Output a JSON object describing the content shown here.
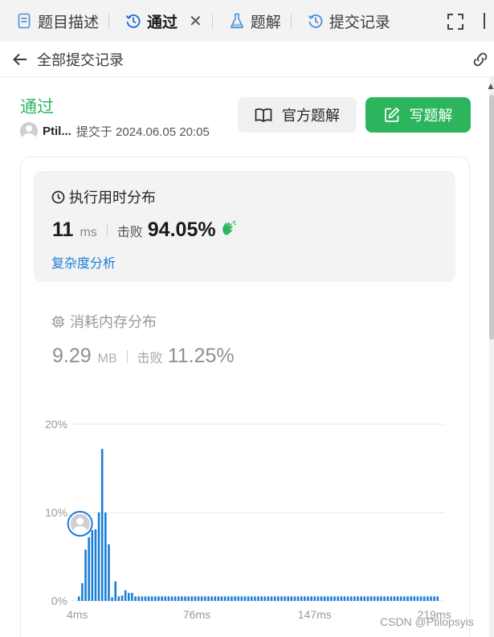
{
  "tabs": [
    {
      "label": "题目描述",
      "icon": "document-icon"
    },
    {
      "label": "通过",
      "icon": "history-icon"
    },
    {
      "label": "题解",
      "icon": "flask-icon"
    },
    {
      "label": "提交记录",
      "icon": "history-icon"
    }
  ],
  "toolbar": {
    "back_label": "全部提交记录"
  },
  "submission": {
    "status": "通过",
    "username": "Ptil...",
    "submitted_at": "提交于 2024.06.05 20:05",
    "official_solution_label": "官方题解",
    "write_solution_label": "写题解"
  },
  "runtime": {
    "title": "执行用时分布",
    "value": "11",
    "unit": "ms",
    "beats_label": "击败",
    "beats_pct": "94.05%",
    "complexity_link": "复杂度分析"
  },
  "memory": {
    "title": "消耗内存分布",
    "value": "9.29",
    "unit": "MB",
    "beats_label": "击败",
    "beats_pct": "11.25%"
  },
  "colors": {
    "accent_green": "#2db55d",
    "bar_blue": "#1a7ed8",
    "link_blue": "#1a7ed8"
  },
  "chart_data": {
    "type": "bar",
    "title": "",
    "xlabel": "",
    "ylabel": "",
    "x_ticks": [
      "4ms",
      "76ms",
      "147ms",
      "219ms"
    ],
    "y_ticks": [
      "0%",
      "10%",
      "20%"
    ],
    "ylim": [
      0,
      20
    ],
    "xlim_ms": [
      1,
      225
    ],
    "grid": true,
    "user_marker_ms": 11,
    "series": [
      {
        "x_ms": [
          5,
          7,
          9,
          11,
          13,
          15,
          17,
          19,
          21,
          23,
          25,
          27,
          29,
          31,
          33,
          35,
          37,
          39,
          41,
          43,
          45,
          47,
          49,
          51,
          53,
          55,
          57,
          59,
          61,
          63,
          65,
          67,
          69,
          71,
          73,
          75,
          77,
          79,
          81,
          83,
          85,
          87,
          89,
          91,
          93,
          95,
          97,
          99,
          101,
          103,
          105,
          107,
          109,
          111,
          113,
          115,
          117,
          119,
          121,
          123,
          125,
          127,
          129,
          131,
          133,
          135,
          137,
          139,
          141,
          143,
          145,
          147,
          149,
          151,
          153,
          155,
          157,
          159,
          161,
          163,
          165,
          167,
          169,
          171,
          173,
          175,
          177,
          179,
          181,
          183,
          185,
          187,
          189,
          191,
          193,
          195,
          197,
          199,
          201,
          203,
          205,
          207,
          209,
          211,
          213,
          215,
          217,
          219,
          221
        ],
        "values": [
          0.5,
          2.0,
          5.8,
          7.2,
          8.0,
          8.1,
          10.0,
          17.2,
          10.0,
          6.4,
          0.4,
          2.2,
          0.5,
          0.6,
          1.2,
          0.9,
          0.9,
          0.5,
          0.5,
          0.5,
          0.5,
          0.5,
          0.5,
          0.5,
          0.5,
          0.5,
          0.5,
          0.5,
          0.5,
          0.5,
          0.5,
          0.5,
          0.5,
          0.5,
          0.5,
          0.5,
          0.5,
          0.5,
          0.5,
          0.5,
          0.5,
          0.5,
          0.5,
          0.5,
          0.5,
          0.5,
          0.5,
          0.5,
          0.5,
          0.5,
          0.5,
          0.5,
          0.5,
          0.5,
          0.5,
          0.5,
          0.5,
          0.5,
          0.5,
          0.5,
          0.5,
          0.5,
          0.5,
          0.5,
          0.5,
          0.5,
          0.5,
          0.5,
          0.5,
          0.5,
          0.5,
          0.5,
          0.5,
          0.5,
          0.5,
          0.5,
          0.5,
          0.5,
          0.5,
          0.5,
          0.5,
          0.5,
          0.5,
          0.5,
          0.5,
          0.5,
          0.5,
          0.5,
          0.5,
          0.5,
          0.5,
          0.5,
          0.5,
          0.5,
          0.5,
          0.5,
          0.5,
          0.5,
          0.5,
          0.5,
          0.5,
          0.5,
          0.5,
          0.5,
          0.5,
          0.5,
          0.5,
          0.5,
          0.5
        ]
      }
    ]
  },
  "watermark": "CSDN @Ptilopsyis"
}
